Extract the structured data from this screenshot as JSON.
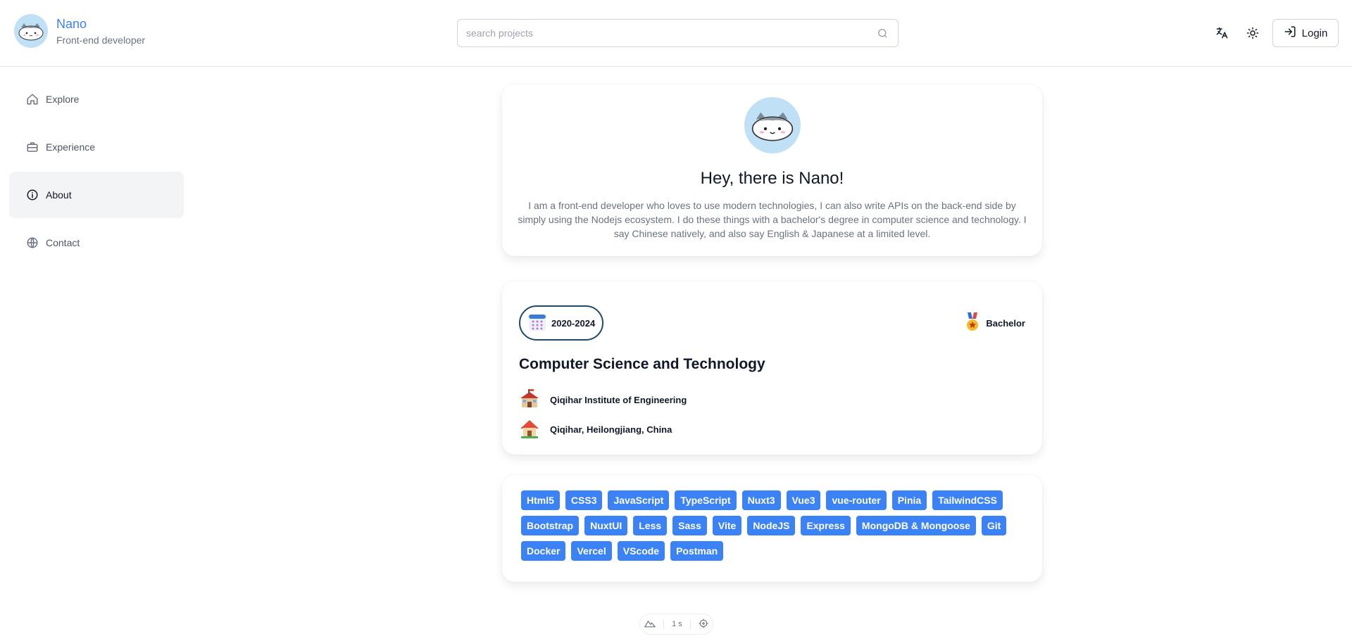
{
  "header": {
    "brand_name": "Nano",
    "brand_role": "Front-end developer",
    "search_placeholder": "search projects",
    "login_label": "Login"
  },
  "sidebar": {
    "items": [
      {
        "label": "Explore",
        "icon": "home-icon"
      },
      {
        "label": "Experience",
        "icon": "briefcase-icon"
      },
      {
        "label": "About",
        "icon": "info-icon",
        "active": true
      },
      {
        "label": "Contact",
        "icon": "globe-icon"
      }
    ]
  },
  "about": {
    "greeting": "Hey, there is Nano!",
    "bio": "I am a front-end developer who loves to use modern technologies, I can also write APIs on the back-end side by simply using the Nodejs ecosystem. I do these things with a bachelor's degree in computer science and technology. I say Chinese natively, and also say English & Japanese at a limited level."
  },
  "education": {
    "years": "2020-2024",
    "degree": "Bachelor",
    "major": "Computer Science and Technology",
    "school": "Qiqihar Institute of Engineering",
    "location": "Qiqihar, Heilongjiang, China"
  },
  "skills": [
    "Html5",
    "CSS3",
    "JavaScript",
    "TypeScript",
    "Nuxt3",
    "Vue3",
    "vue-router",
    "Pinia",
    "TailwindCSS",
    "Bootstrap",
    "NuxtUI",
    "Less",
    "Sass",
    "Vite",
    "NodeJS",
    "Express",
    "MongoDB & Mongoose",
    "Git",
    "Docker",
    "Vercel",
    "VScode",
    "Postman"
  ],
  "dev_toolbar": {
    "timer": "1 s"
  },
  "colors": {
    "accent": "#3b82f6",
    "pill_border": "#1e4a6a",
    "avatar_bg": "#bfe0f5"
  }
}
